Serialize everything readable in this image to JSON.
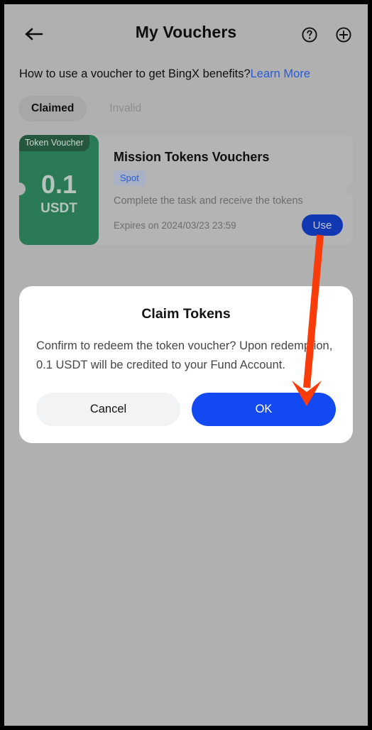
{
  "header": {
    "title": "My Vouchers",
    "back_icon": "back-arrow-icon",
    "help_icon": "question-circle-icon",
    "add_icon": "plus-circle-icon"
  },
  "info_line": {
    "text": "How to use a voucher to get BingX benefits?",
    "link_label": "Learn More",
    "link_color": "#2a5bd7"
  },
  "tabs": [
    {
      "label": "Claimed",
      "active": true
    },
    {
      "label": "Invalid",
      "active": false
    }
  ],
  "voucher": {
    "type_badge": "Token Voucher",
    "amount": "0.1",
    "currency": "USDT",
    "title": "Mission Tokens Vouchers",
    "tag": "Spot",
    "description": "Complete the task and receive the tokens",
    "expiry": "Expires on 2024/03/23 23:59",
    "use_label": "Use",
    "accent_green": "#2a7a56",
    "badge_green": "#25573f",
    "use_button_color": "#1137b3"
  },
  "modal": {
    "title": "Claim Tokens",
    "body": "Confirm to redeem the token voucher? Upon redemption, 0.1 USDT will be credited to your Fund Account.",
    "cancel_label": "Cancel",
    "ok_label": "OK",
    "ok_color": "#1249f0",
    "cancel_color": "#f2f3f5"
  },
  "annotation": {
    "arrow_color": "#fa3c0a",
    "arrow_from": "Use button",
    "arrow_to": "OK button"
  }
}
